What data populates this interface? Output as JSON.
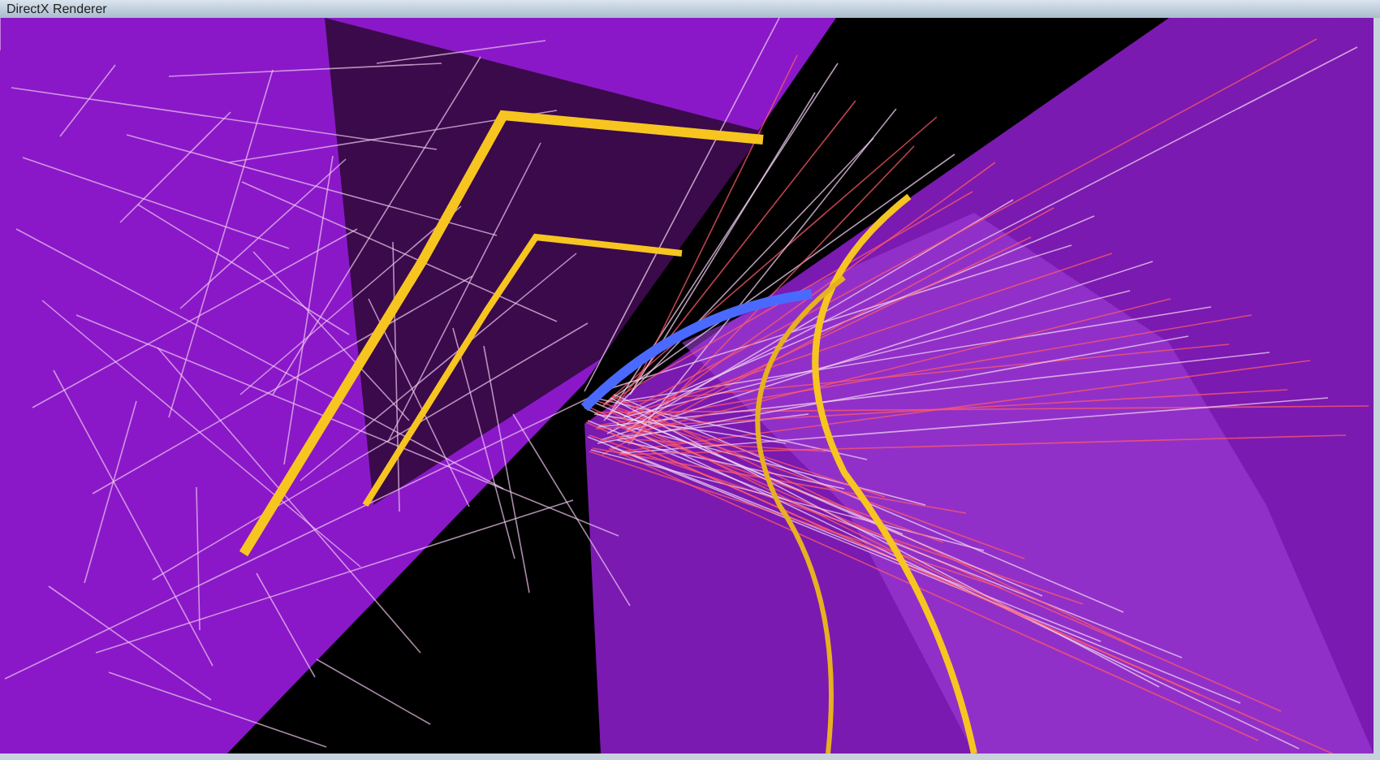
{
  "window": {
    "title": "DirectX Renderer"
  }
}
